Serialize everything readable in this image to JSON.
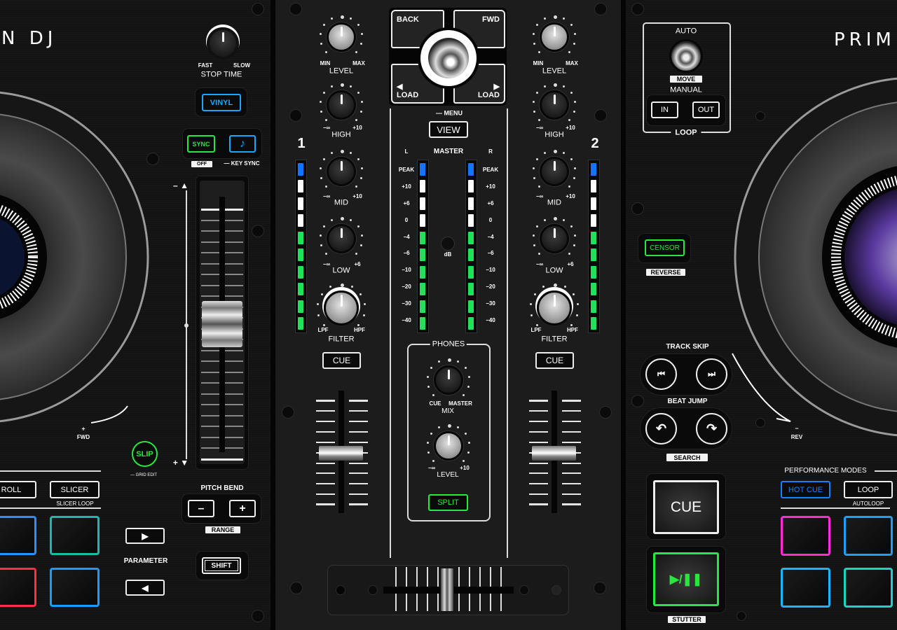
{
  "brand": {
    "left_logo": "N DJ",
    "right_logo": "PRIM"
  },
  "colors": {
    "green": "#27e83c",
    "blue": "#1aa7ff",
    "magenta": "#ff2ad8",
    "red": "#ff2e4c",
    "teal": "#1ccfbf",
    "meter_peak": "#1473ff",
    "meter_mid": "#ffffff",
    "meter_low": "#22e05a"
  },
  "left_deck": {
    "stop_time": {
      "fast": "FAST",
      "slow": "SLOW",
      "label": "STOP TIME"
    },
    "vinyl": "VINYL",
    "sync": "SYNC",
    "key_icon": "music-note-icon",
    "off_label": "OFF",
    "key_sync": "— KEY SYNC",
    "pitch_minus": "– ▲",
    "pitch_plus": "+ ▼",
    "slip": "SLIP",
    "grid_edit": "— GRID EDIT",
    "fwd_plus": "+",
    "fwd": "FWD",
    "modes": {
      "roll": "ROLL",
      "slicer": "SLICER",
      "slicer_loop": "SLICER LOOP"
    },
    "parameter": {
      "next": "▶",
      "label": "PARAMETER",
      "prev": "◀"
    },
    "pitch_bend": {
      "label": "PITCH BEND",
      "minus": "–",
      "plus": "+",
      "range": "RANGE"
    },
    "shift": "SHIFT"
  },
  "mixer": {
    "channel1": {
      "number": "1",
      "level_min": "MIN",
      "level_max": "MAX",
      "level": "LEVEL",
      "eq_min": "−∞",
      "high_max": "+10",
      "high": "HIGH",
      "mid_max": "+10",
      "mid": "MID",
      "low_max": "+6",
      "low": "LOW",
      "lpf": "LPF",
      "hpf": "HPF",
      "filter": "FILTER",
      "cue": "CUE"
    },
    "channel2": {
      "number": "2",
      "level_min": "MIN",
      "level_max": "MAX",
      "level": "LEVEL",
      "eq_min": "−∞",
      "high_max": "+10",
      "high": "HIGH",
      "mid_max": "+10",
      "mid": "MID",
      "low_max": "+6",
      "low": "LOW",
      "lpf": "LPF",
      "hpf": "HPF",
      "filter": "FILTER",
      "cue": "CUE"
    },
    "browse": {
      "back": "BACK",
      "fwd": "FWD",
      "load_left_arrow": "◀",
      "load_left": "LOAD",
      "load_right_arrow": "▶",
      "load_right": "LOAD"
    },
    "menu": "— MENU",
    "view": "VIEW",
    "master": {
      "l": "L",
      "title": "MASTER",
      "r": "R",
      "db": "dB",
      "scale": [
        "PEAK",
        "+10",
        "+6",
        "0",
        "−4",
        "−6",
        "−10",
        "−20",
        "−30",
        "−40"
      ]
    },
    "meter_colors": [
      "peak",
      "mid",
      "mid",
      "mid",
      "low",
      "low",
      "low",
      "low",
      "low",
      "low"
    ],
    "phones": {
      "title": "PHONES",
      "cue": "CUE",
      "master": "MASTER",
      "mix": "MIX",
      "min": "−∞",
      "max": "+10",
      "level": "LEVEL",
      "split": "SPLIT"
    }
  },
  "right_deck": {
    "loop": {
      "auto": "AUTO",
      "move": "MOVE",
      "manual": "MANUAL",
      "in": "IN",
      "out": "OUT",
      "title": "LOOP"
    },
    "censor": "CENSOR",
    "reverse": "REVERSE",
    "track_skip": "TRACK SKIP",
    "beat_jump": "BEAT JUMP",
    "search": "SEARCH",
    "rev_minus": "–",
    "rev": "REV",
    "performance_modes": "PERFORMANCE MODES",
    "hot_cue": "HOT CUE",
    "loop_mode": "LOOP",
    "autoloop": "AUTOLOOP",
    "cue": "CUE",
    "play_pause": "▶/❚❚",
    "stutter": "STUTTER"
  }
}
